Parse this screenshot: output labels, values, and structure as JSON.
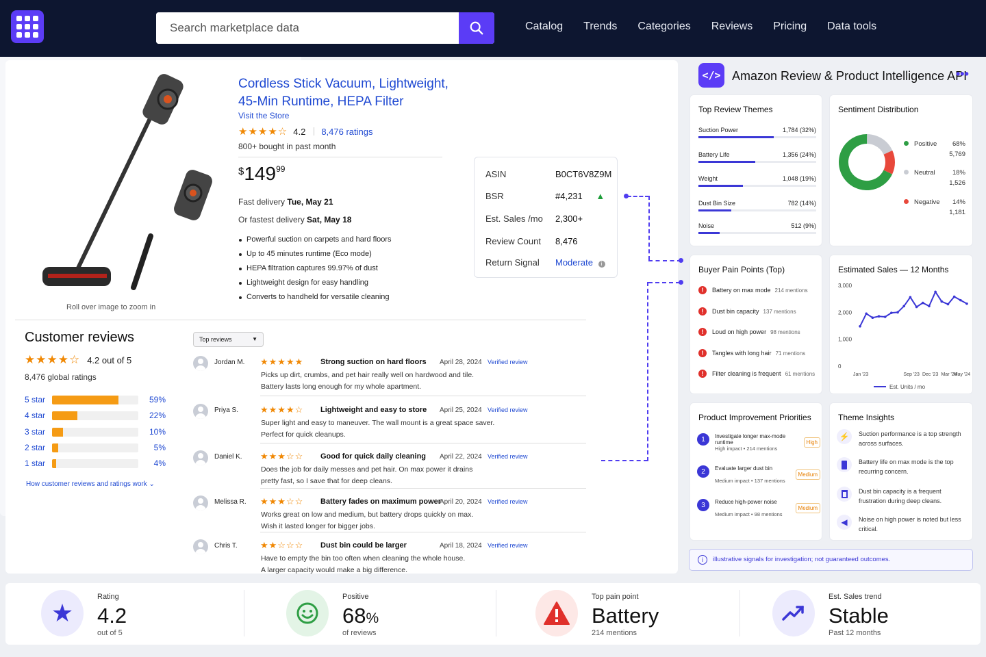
{
  "header": {
    "search_placeholder": "Search marketplace data",
    "nav": [
      "Catalog",
      "Trends",
      "Categories",
      "Reviews",
      "Pricing",
      "Data tools"
    ]
  },
  "product": {
    "title": "Cordless Stick Vacuum, Lightweight, 45-Min Runtime, HEPA Filter",
    "store": "Visit the Store",
    "stars": "★★★★☆",
    "rating": "4.2",
    "ratings_count": "8,476 ratings",
    "bought": "800+ bought in past month",
    "price_dollar": "$",
    "price_whole": "149",
    "price_cents": "99",
    "delivery_label": "Fast delivery",
    "delivery_date": "Tue, May 21",
    "fastest_label": "Or fastest delivery",
    "fastest_date": "Sat, May 18",
    "bullets": [
      "Powerful suction on carpets and hard floors",
      "Up to 45 minutes runtime (Eco mode)",
      "HEPA filtration captures 99.97% of dust",
      "Lightweight design for easy handling",
      "Converts to handheld for versatile cleaning"
    ],
    "zoom_hint": "Roll over image to zoom in"
  },
  "info": {
    "rows": [
      {
        "label": "ASIN",
        "value": "B0CT6V8Z9M"
      },
      {
        "label": "BSR",
        "value": "#4,231"
      },
      {
        "label": "Est. Sales /mo",
        "value": "2,300+"
      },
      {
        "label": "Review Count",
        "value": "8,476"
      },
      {
        "label": "Return Signal",
        "value": "Moderate"
      }
    ],
    "accent": "#1f49d2",
    "up_color": "#1e9e3a"
  },
  "customer_reviews": {
    "title": "Customer reviews",
    "stars": "★★★★☆",
    "summary": "4.2 out of 5",
    "global": "8,476 global ratings",
    "bars": [
      {
        "label": "5 star",
        "pct": "59%",
        "value": 59
      },
      {
        "label": "4 star",
        "pct": "22%",
        "value": 22
      },
      {
        "label": "3 star",
        "pct": "10%",
        "value": 10
      },
      {
        "label": "2 star",
        "pct": "5%",
        "value": 5
      },
      {
        "label": "1 star",
        "pct": "4%",
        "value": 4
      }
    ],
    "how_link": "How customer reviews and ratings work",
    "sort": "Top reviews",
    "list": [
      {
        "name": "Jordan M.",
        "stars": "★★★★★",
        "headline": "Strong suction on hard floors",
        "date": "April 28, 2024",
        "verified": "Verified review",
        "body": "Picks up dirt, crumbs, and pet hair really well on hardwood and tile.\nBattery lasts long enough for my whole apartment."
      },
      {
        "name": "Priya S.",
        "stars": "★★★★☆",
        "headline": "Lightweight and easy to store",
        "date": "April 25, 2024",
        "verified": "Verified review",
        "body": "Super light and easy to maneuver. The wall mount is a great space saver.\nPerfect for quick cleanups."
      },
      {
        "name": "Daniel K.",
        "stars": "★★★☆☆",
        "headline": "Good for quick daily cleaning",
        "date": "April 22, 2024",
        "verified": "Verified review",
        "body": "Does the job for daily messes and pet hair. On max power it drains\npretty fast, so I save that for deep cleans."
      },
      {
        "name": "Melissa R.",
        "stars": "★★★☆☆",
        "headline": "Battery fades on maximum power",
        "date": "April 20, 2024",
        "verified": "Verified review",
        "body": "Works great on low and medium, but battery drops quickly on max.\nWish it lasted longer for bigger jobs."
      },
      {
        "name": "Chris T.",
        "stars": "★★☆☆☆",
        "headline": "Dust bin could be larger",
        "date": "April 18, 2024",
        "verified": "Verified review",
        "body": "Have to empty the bin too often when cleaning the whole house.\nA larger capacity would make a big difference."
      }
    ]
  },
  "api": {
    "icon": "</>",
    "title": "Amazon Review & Product Intelligence API",
    "more": "•••",
    "themes": {
      "title": "Top Review Themes",
      "items": [
        {
          "name": "Suction Power",
          "value": "1,784 (32%)",
          "pct": 32
        },
        {
          "name": "Battery Life",
          "value": "1,356 (24%)",
          "pct": 24
        },
        {
          "name": "Weight",
          "value": "1,048 (19%)",
          "pct": 19
        },
        {
          "name": "Dust Bin Size",
          "value": "782 (14%)",
          "pct": 14
        },
        {
          "name": "Noise",
          "value": "512 (9%)",
          "pct": 9
        }
      ]
    },
    "sentiment": {
      "title": "Sentiment Distribution",
      "items": [
        {
          "name": "Positive",
          "pct": "68%",
          "count": "5,769",
          "value": 68,
          "color": "#2e9e44"
        },
        {
          "name": "Neutral",
          "pct": "18%",
          "count": "1,526",
          "value": 18,
          "color": "#c9ccd3"
        },
        {
          "name": "Negative",
          "pct": "14%",
          "count": "1,181",
          "value": 14,
          "color": "#e8483b"
        }
      ]
    },
    "pain": {
      "title": "Buyer Pain Points (Top)",
      "items": [
        {
          "name": "Battery on max mode",
          "mentions": "214 mentions"
        },
        {
          "name": "Dust bin capacity",
          "mentions": "137 mentions"
        },
        {
          "name": "Loud on high power",
          "mentions": "98 mentions"
        },
        {
          "name": "Tangles with long hair",
          "mentions": "71 mentions"
        },
        {
          "name": "Filter cleaning is frequent",
          "mentions": "61 mentions"
        }
      ]
    },
    "sales": {
      "title": "Estimated Sales — 12 Months",
      "legend": "Est. Units / mo"
    },
    "priorities": {
      "title": "Product Improvement Priorities",
      "items": [
        {
          "n": "1",
          "text": "Investigate longer max-mode runtime",
          "meta": "High impact • 214 mentions",
          "badge": "High"
        },
        {
          "n": "2",
          "text": "Evaluate larger dust bin",
          "meta": "Medium impact • 137 mentions",
          "badge": "Medium"
        },
        {
          "n": "3",
          "text": "Reduce high-power noise",
          "meta": "Medium impact • 98 mentions",
          "badge": "Medium"
        }
      ]
    },
    "insights": {
      "title": "Theme Insights",
      "items": [
        {
          "icon": "bolt-icon",
          "text": "Suction performance is a top strength across surfaces."
        },
        {
          "icon": "battery-icon",
          "text": "Battery life on max mode is the top recurring concern."
        },
        {
          "icon": "trash-bin-icon",
          "text": "Dust bin capacity is a frequent frustration during deep cleans."
        },
        {
          "icon": "speaker-icon",
          "text": "Noise on high power is noted but less critical."
        }
      ]
    },
    "note": "illustrative signals for investigation; not guaranteed outcomes."
  },
  "chart_data": {
    "type": "line",
    "title": "Estimated Sales — 12 Months",
    "x": [
      "Jan '23",
      "Feb '23",
      "Mar '23",
      "Apr '23",
      "May '23",
      "Jun '23",
      "Jul '23",
      "Aug '23",
      "Sep '23",
      "Oct '23",
      "Nov '23",
      "Dec '23",
      "Jan '24",
      "Feb '24",
      "Mar '24",
      "Apr '24",
      "May '24",
      "Jun '24"
    ],
    "xticks": [
      "Jan '23",
      "Sep '23",
      "Dec '23",
      "Mar '24",
      "May '24"
    ],
    "series": [
      {
        "name": "Est. Units / mo",
        "values": [
          1480,
          1950,
          1800,
          1850,
          1830,
          1980,
          2000,
          2230,
          2560,
          2200,
          2350,
          2230,
          2760,
          2400,
          2300,
          2580,
          2450,
          2320
        ]
      }
    ],
    "ylim": [
      0,
      3000
    ],
    "yticks": [
      "3,000",
      "2,000",
      "1,000",
      "0"
    ],
    "color": "#3b37d6"
  },
  "kpis": [
    {
      "label": "Rating",
      "value": "4.2",
      "sub": "out of 5",
      "icon": "star-icon",
      "color": "#3b37d6",
      "bg": "#ecebfd"
    },
    {
      "label": "Positive",
      "value": "68",
      "unit": "%",
      "sub": "of reviews",
      "icon": "smile-icon",
      "color": "#2e9e44",
      "bg": "#e3f4e6"
    },
    {
      "label": "Top pain point",
      "value": "Battery",
      "sub": "214 mentions",
      "icon": "warning-icon",
      "color": "#e0302b",
      "bg": "#fde8e6"
    },
    {
      "label": "Est. Sales trend",
      "value": "Stable",
      "sub": "Past 12 months",
      "icon": "trend-up-icon",
      "color": "#3b37d6",
      "bg": "#ecebfd"
    }
  ]
}
